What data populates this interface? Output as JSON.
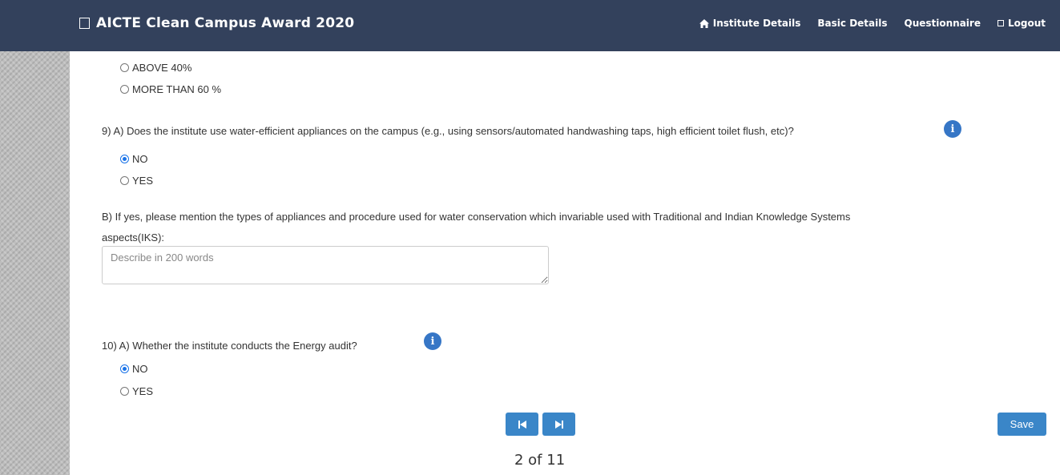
{
  "nav": {
    "brand": "AICTE Clean Campus Award 2020",
    "links": {
      "institute_details": "Institute Details",
      "basic_details": "Basic Details",
      "questionnaire": "Questionnaire",
      "logout": "Logout"
    }
  },
  "prev_question": {
    "options": [
      "ABOVE 40%",
      "MORE THAN 60 %"
    ]
  },
  "q9": {
    "question_a": "9) A) Does the institute use water-efficient appliances on the campus (e.g., using sensors/automated handwashing taps, high efficient toilet flush, etc)?",
    "options": [
      "NO",
      "YES"
    ],
    "selected": "NO",
    "question_b_line1": "B) If yes, please mention the types of appliances and procedure used for water conservation which invariable used with Traditional and Indian Knowledge Systems",
    "question_b_line2": "aspects(IKS):",
    "textarea_placeholder": "Describe in 200 words"
  },
  "q10": {
    "question_a": "10) A) Whether the institute conducts the Energy audit?",
    "options": [
      "NO",
      "YES"
    ],
    "selected": "NO"
  },
  "footer": {
    "save_label": "Save",
    "page_indicator": "2 of 11"
  },
  "colors": {
    "navbar": "#33415c",
    "accent": "#3a86c8",
    "info_icon": "#3676c6"
  }
}
